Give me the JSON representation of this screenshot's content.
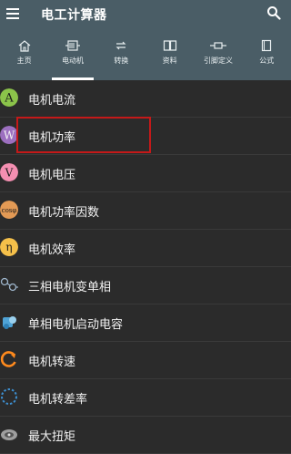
{
  "app": {
    "title": "电工计算器"
  },
  "tabs": [
    {
      "label": "主页",
      "icon": "home-icon",
      "active": false
    },
    {
      "label": "电动机",
      "icon": "motor-icon",
      "active": true
    },
    {
      "label": "转换",
      "icon": "convert-icon",
      "active": false
    },
    {
      "label": "资料",
      "icon": "book-icon",
      "active": false
    },
    {
      "label": "引脚定义",
      "icon": "pin-icon",
      "active": false
    },
    {
      "label": "公式",
      "icon": "formula-icon",
      "active": false
    }
  ],
  "list": [
    {
      "label": "电机电流",
      "icon": "letter-a-icon",
      "glyph": "A",
      "color": "#8bc34a"
    },
    {
      "label": "电机功率",
      "icon": "letter-w-icon",
      "glyph": "W",
      "color": "#9c6fbf"
    },
    {
      "label": "电机电压",
      "icon": "letter-v-icon",
      "glyph": "V",
      "color": "#f48fb1"
    },
    {
      "label": "电机功率因数",
      "icon": "cos-phi-icon",
      "glyph": "cosφ",
      "color": "#e39a55"
    },
    {
      "label": "电机效率",
      "icon": "eta-icon",
      "glyph": "η",
      "color": "#f5c04a"
    },
    {
      "label": "三相电机变单相",
      "icon": "phase-convert-icon",
      "glyph": "",
      "color": "#6f8fb0"
    },
    {
      "label": "单相电机启动电容",
      "icon": "capacitor-icon",
      "glyph": "",
      "color": "#4fa3d6"
    },
    {
      "label": "电机转速",
      "icon": "rotation-icon",
      "glyph": "",
      "color": "#ff8a1d"
    },
    {
      "label": "电机转差率",
      "icon": "slip-icon",
      "glyph": "",
      "color": "#3d8fd0"
    },
    {
      "label": "最大扭矩",
      "icon": "torque-icon",
      "glyph": "",
      "color": "#9e9e9e"
    }
  ],
  "highlight": {
    "item": "电机功率",
    "color": "#c41919"
  },
  "colors": {
    "appbar": "#4a5d66",
    "background": "#2b2b2b"
  }
}
